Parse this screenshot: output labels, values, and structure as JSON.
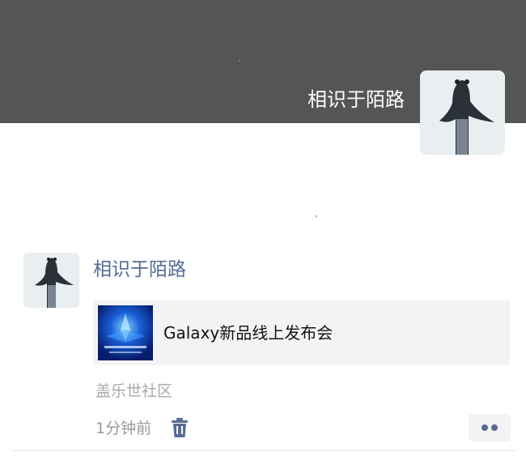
{
  "profile": {
    "name": "相识于陌路",
    "avatar_icon": "girl-long-hair-photo",
    "cover_color": "#555555"
  },
  "post": {
    "author": "相识于陌路",
    "avatar_icon": "girl-long-hair-photo",
    "link": {
      "title": "Galaxy新品线上发布会",
      "thumbnail_icon": "galaxy-event-poster"
    },
    "source": "盖乐世社区",
    "time": "1分钟前",
    "delete_icon": "trash-icon",
    "more_icon": "more-dots-icon"
  },
  "colors": {
    "name_link": "#566b94",
    "muted_text": "#9a9a9a",
    "card_bg": "#f3f3f5"
  }
}
